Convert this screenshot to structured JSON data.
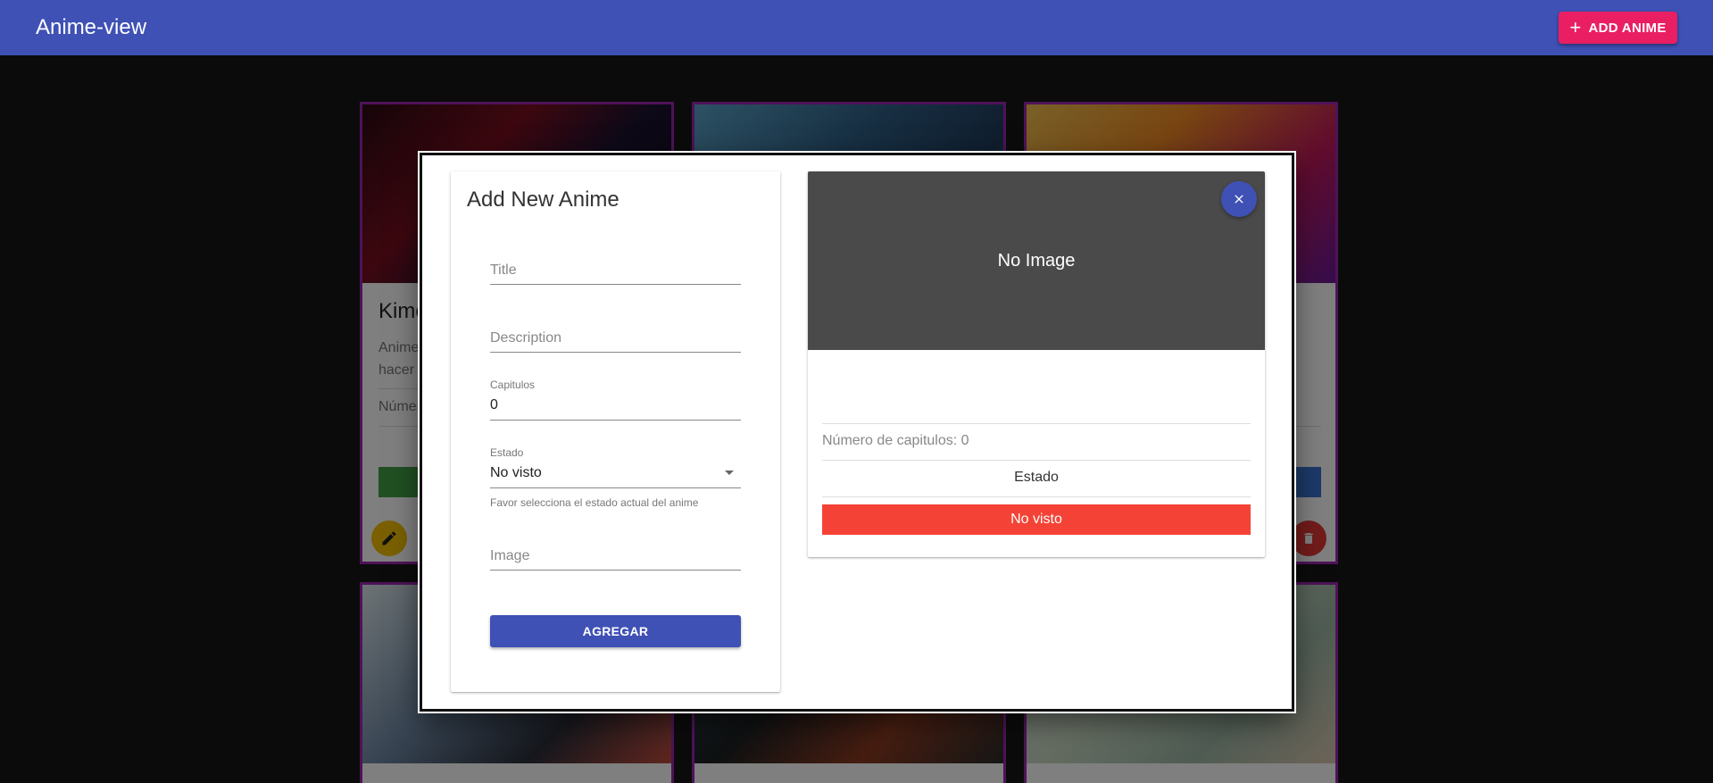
{
  "app": {
    "title": "Anime-view",
    "add_button_label": "ADD ANIME",
    "colors": {
      "primary": "#3f51b5",
      "accent": "#e91e63",
      "card_border": "#9c27b0"
    }
  },
  "background_cards": [
    {
      "title": "Kime",
      "description": "Anime\nhacer t",
      "count_text": "Númer"
    }
  ],
  "dialog": {
    "form": {
      "title": "Add New Anime",
      "title_placeholder": "Title",
      "description_placeholder": "Description",
      "capitulos_label": "Capitulos",
      "capitulos_value": "0",
      "estado_label": "Estado",
      "estado_value": "No visto",
      "estado_helper": "Favor selecciona el estado actual del anime",
      "image_placeholder": "Image",
      "submit_label": "AGREGAR"
    },
    "preview": {
      "no_image_text": "No Image",
      "chapters_text": "Número de capitulos: 0",
      "estado_label": "Estado",
      "status_text": "No visto",
      "status_color": "#f44336"
    }
  }
}
